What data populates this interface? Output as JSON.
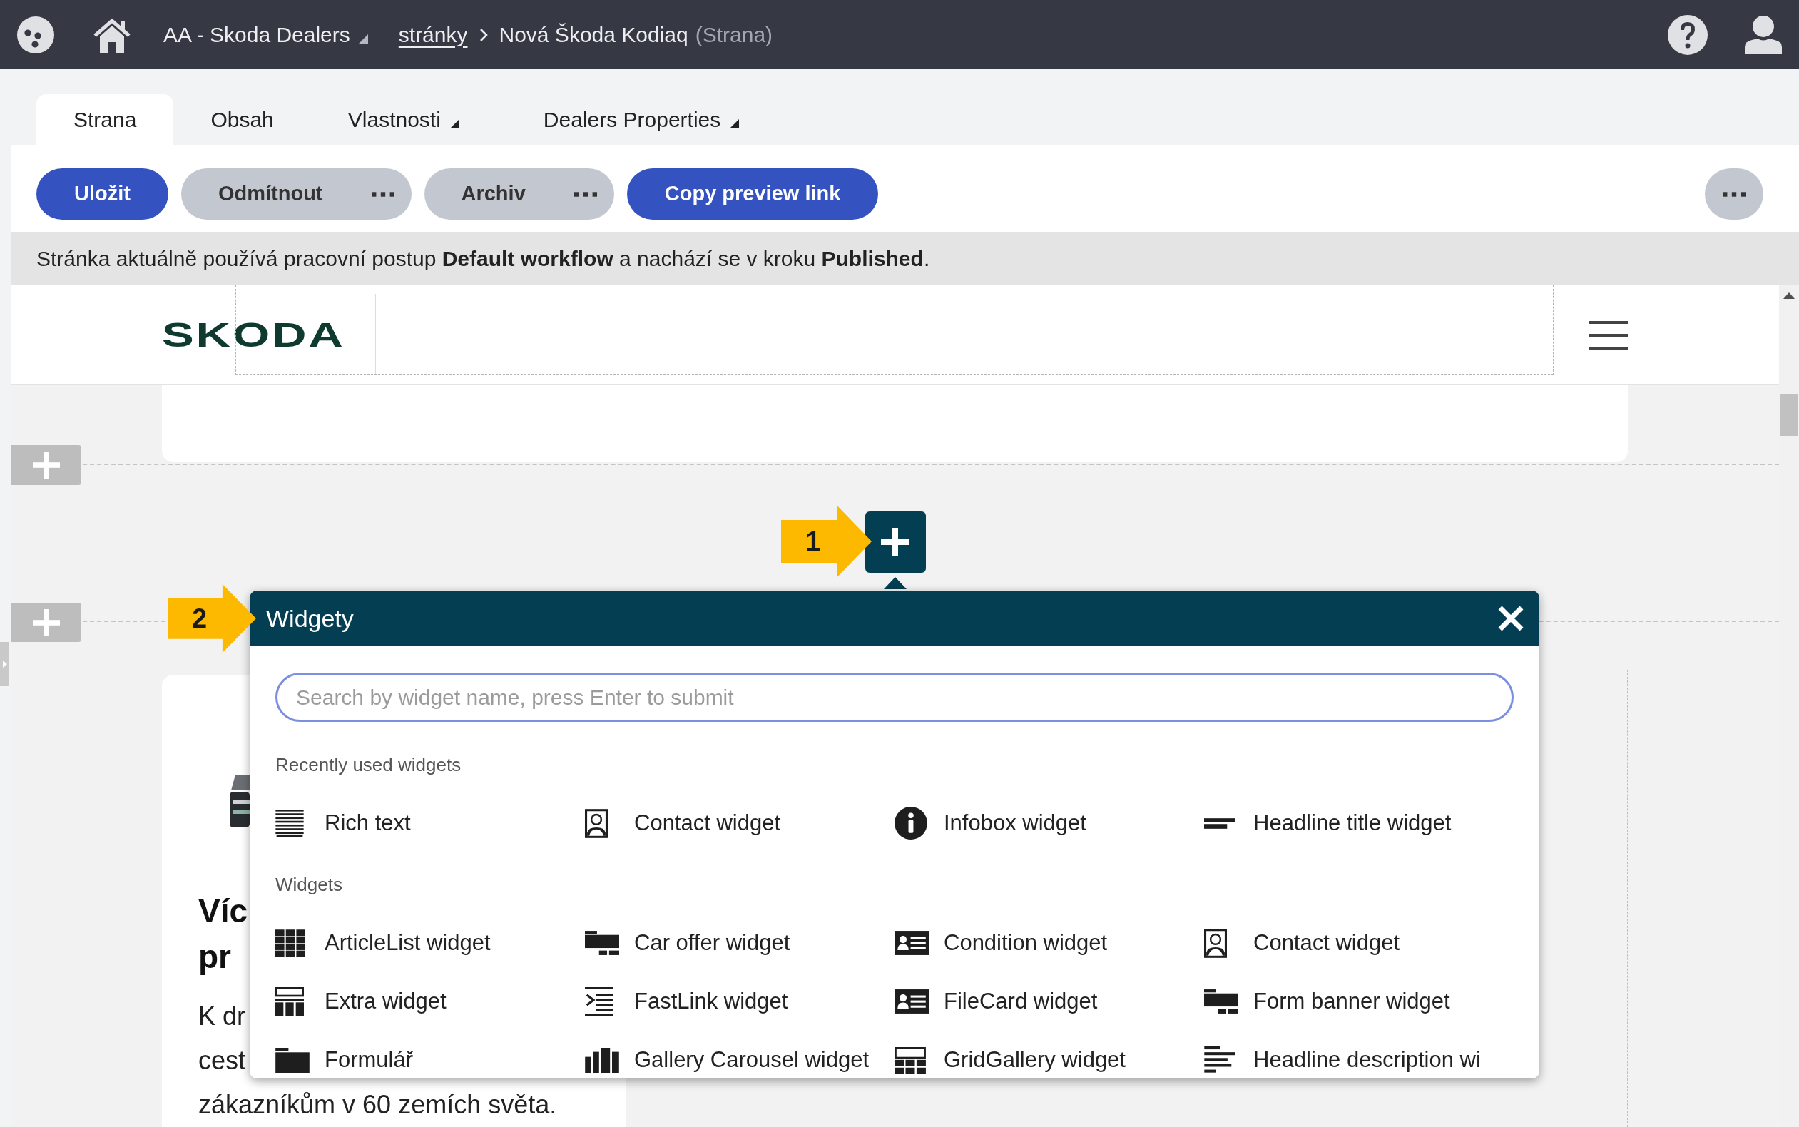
{
  "top_bar": {
    "site": "AA - Skoda Dealers",
    "breadcrumb": [
      {
        "label": "stránky",
        "kind": "link"
      },
      {
        "label": "Nová Škoda Kodiaq",
        "kind": "current"
      }
    ],
    "page_type": "(Strana)"
  },
  "tabs": [
    {
      "label": "Strana",
      "selected": true,
      "dropdown": false
    },
    {
      "label": "Obsah",
      "selected": false,
      "dropdown": false
    },
    {
      "label": "Vlastnosti",
      "selected": false,
      "dropdown": true
    },
    {
      "label": "Dealers Properties",
      "selected": false,
      "dropdown": true
    }
  ],
  "toolbar": {
    "buttons": [
      {
        "label": "Uložit",
        "kind": "primary",
        "more": false
      },
      {
        "label": "Odmítnout",
        "kind": "secondary",
        "more": true
      },
      {
        "label": "Archiv",
        "kind": "secondary",
        "more": true
      },
      {
        "label": "Copy preview link",
        "kind": "primary",
        "more": false
      }
    ]
  },
  "workflow_notice": "Stránka aktuálně používá pracovní postup **Default workflow** a nachází se v kroku **Published**.",
  "preview": {
    "logo": "SKODA",
    "add_widget_button": {
      "callout": "1"
    },
    "content": {
      "heading_lines": [
        "Víc",
        "pr"
      ],
      "body_lines": [
        "K dr",
        "cest",
        "zákazníkům v 60 zemích světa."
      ]
    }
  },
  "widget_dialog": {
    "callout": "2",
    "title": "Widgety",
    "search": {
      "placeholder": "Search by widget name, press Enter to submit"
    },
    "sections": [
      {
        "title": "Recently used widgets",
        "items": [
          {
            "label": "Rich text",
            "kind": "richtext"
          },
          {
            "label": "Contact widget",
            "kind": "contact"
          },
          {
            "label": "Infobox widget",
            "kind": "info"
          },
          {
            "label": "Headline title widget",
            "kind": "headline"
          }
        ]
      },
      {
        "title": "Widgets",
        "items": [
          {
            "label": "ArticleList widget",
            "kind": "grid"
          },
          {
            "label": "Car offer widget",
            "kind": "banner"
          },
          {
            "label": "Condition widget",
            "kind": "card"
          },
          {
            "label": "Contact widget",
            "kind": "contact"
          },
          {
            "label": "Extra widget",
            "kind": "extra"
          },
          {
            "label": "FastLink widget",
            "kind": "fastlink"
          },
          {
            "label": "FileCard widget",
            "kind": "card"
          },
          {
            "label": "Form banner widget",
            "kind": "banner"
          },
          {
            "label": "Formulář",
            "kind": "folder"
          },
          {
            "label": "Gallery Carousel widget",
            "kind": "carousel"
          },
          {
            "label": "GridGallery widget",
            "kind": "gallery"
          },
          {
            "label": "Headline description wi",
            "kind": "description"
          }
        ]
      }
    ]
  }
}
